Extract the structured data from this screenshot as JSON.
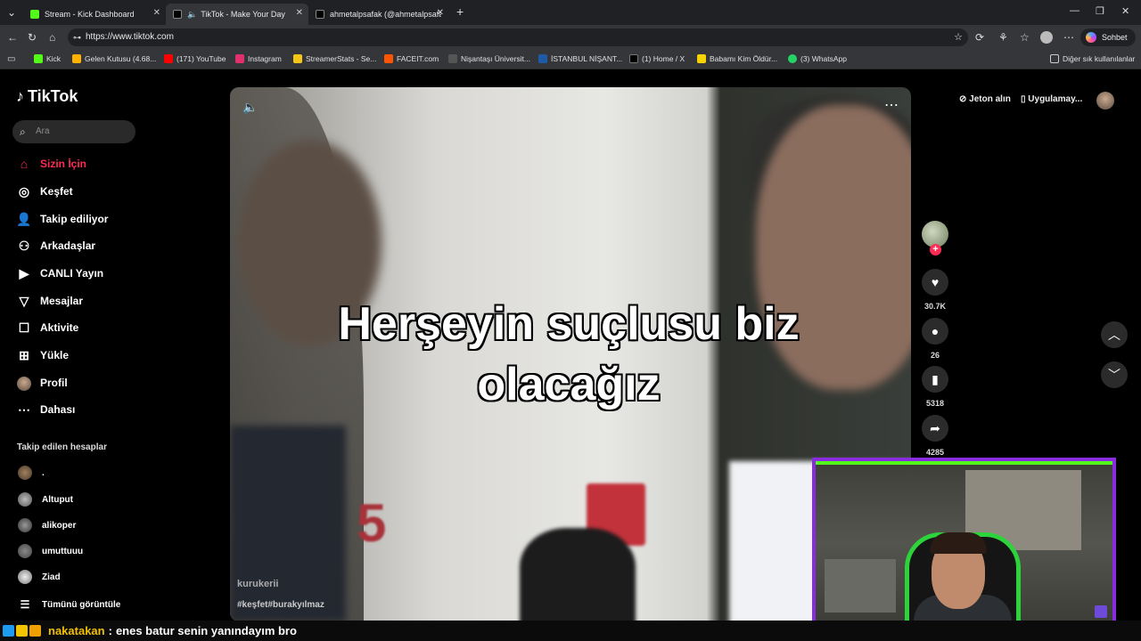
{
  "browser": {
    "tabs": [
      {
        "label": "Stream - Kick Dashboard",
        "active": false,
        "color": "#53fc18"
      },
      {
        "label": "TikTok - Make Your Day",
        "active": true,
        "color": "#ffffff"
      },
      {
        "label": "ahmetalpsafak (@ahmetalpsafak) |",
        "active": false,
        "color": "#ffffff"
      }
    ],
    "url": "https://www.tiktok.com",
    "copilot_label": "Sohbet et",
    "bookmarks": [
      {
        "label": "Kick",
        "color": "#53fc18"
      },
      {
        "label": "Gelen Kutusu (4.68...",
        "color": "#ffb300"
      },
      {
        "label": "(171) YouTube",
        "color": "#ff0000"
      },
      {
        "label": "Instagram",
        "color": "#e1306c"
      },
      {
        "label": "StreamerStats - Se...",
        "color": "#f5c518"
      },
      {
        "label": "FACEIT.com",
        "color": "#ff5500"
      },
      {
        "label": "Nişantaşı Üniversit...",
        "color": "#555555"
      },
      {
        "label": "İSTANBUL NİŞANT...",
        "color": "#1e5aa8"
      },
      {
        "label": "(1) Home / X",
        "color": "#000000"
      },
      {
        "label": "Babamı Kim Öldür...",
        "color": "#f5d300"
      },
      {
        "label": "(3) WhatsApp",
        "color": "#25d366"
      }
    ],
    "other_bookmarks": "Diğer sık kullanılanlar"
  },
  "tiktok": {
    "logo": "TikTok",
    "search_placeholder": "Ara",
    "nav": [
      {
        "label": "Sizin İçin",
        "icon": "home-icon",
        "selected": true
      },
      {
        "label": "Keşfet",
        "icon": "compass-icon",
        "selected": false
      },
      {
        "label": "Takip ediliyor",
        "icon": "following-icon",
        "selected": false
      },
      {
        "label": "Arkadaşlar",
        "icon": "friends-icon",
        "selected": false
      },
      {
        "label": "CANLI Yayın",
        "icon": "live-icon",
        "selected": false
      },
      {
        "label": "Mesajlar",
        "icon": "messages-icon",
        "selected": false
      },
      {
        "label": "Aktivite",
        "icon": "activity-icon",
        "selected": false
      },
      {
        "label": "Yükle",
        "icon": "upload-icon",
        "selected": false
      },
      {
        "label": "Profil",
        "icon": "profile-avatar",
        "selected": false
      },
      {
        "label": "Dahası",
        "icon": "more-icon",
        "selected": false
      }
    ],
    "following_title": "Takip edilen hesaplar",
    "following": [
      ".",
      "Altuput",
      "alikoper",
      "umuttuuu",
      "Ziad"
    ],
    "see_all": "Tümünü görüntüle",
    "top_right": {
      "coins": "Jeton alın",
      "app": "Uygulamay..."
    },
    "video": {
      "caption_line1": "Herşeyin suçlusu biz",
      "caption_line2": "olacağız",
      "author": "kurukerii",
      "hashtags": "#keşfet#burakyılmaz"
    },
    "actions": {
      "likes": "30.7K",
      "comments": "26",
      "saves": "5318",
      "shares": "4285"
    }
  },
  "chat": {
    "username": "nakatakan",
    "separator": ":",
    "message": "enes batur senin yanındayım bro"
  }
}
